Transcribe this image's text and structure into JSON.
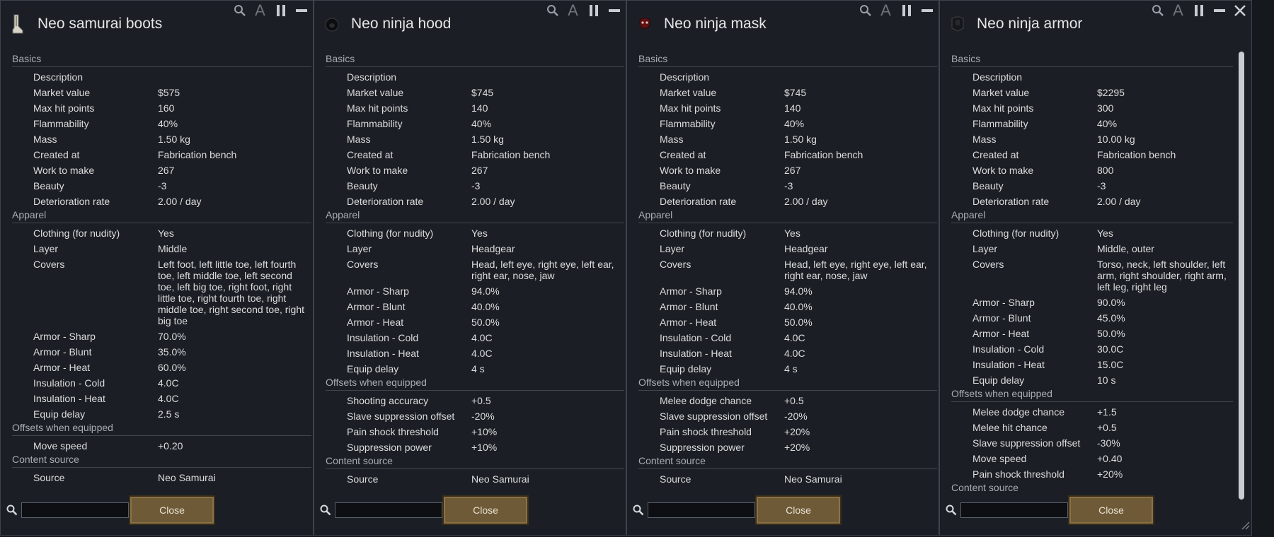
{
  "window_controls": [
    {
      "name": "search-icon",
      "glyph": "🔍"
    },
    {
      "name": "text-icon",
      "glyph": "A"
    },
    {
      "name": "pause-icon",
      "glyph": "II"
    },
    {
      "name": "minimize-icon",
      "glyph": "▬"
    }
  ],
  "close_x": "✕",
  "footer": {
    "close_label": "Close",
    "search_placeholder": ""
  },
  "panels": [
    {
      "title": "Neo samurai boots",
      "icon": "boots-icon",
      "sections": [
        {
          "title": "Basics",
          "rows": [
            [
              "Description",
              ""
            ],
            [
              "Market value",
              "$575"
            ],
            [
              "Max hit points",
              "160"
            ],
            [
              "Flammability",
              "40%"
            ],
            [
              "Mass",
              "1.50 kg"
            ],
            [
              "Created at",
              "Fabrication bench"
            ],
            [
              "Work to make",
              "267"
            ],
            [
              "Beauty",
              "-3"
            ],
            [
              "Deterioration rate",
              "2.00 / day"
            ]
          ]
        },
        {
          "title": "Apparel",
          "rows": [
            [
              "Clothing (for nudity)",
              "Yes"
            ],
            [
              "Layer",
              "Middle"
            ],
            [
              "Covers",
              "Left foot, left little toe, left fourth toe, left middle toe, left second toe, left big toe, right foot, right little toe, right fourth toe, right middle toe, right second toe, right big toe"
            ],
            [
              "Armor - Sharp",
              "70.0%"
            ],
            [
              "Armor - Blunt",
              "35.0%"
            ],
            [
              "Armor - Heat",
              "60.0%"
            ],
            [
              "Insulation - Cold",
              "4.0C"
            ],
            [
              "Insulation - Heat",
              "4.0C"
            ],
            [
              "Equip delay",
              "2.5 s"
            ]
          ]
        },
        {
          "title": "Offsets when equipped",
          "rows": [
            [
              "Move speed",
              "+0.20"
            ]
          ]
        },
        {
          "title": "Content source",
          "rows": [
            [
              "Source",
              "Neo Samurai"
            ]
          ]
        }
      ]
    },
    {
      "title": "Neo ninja hood",
      "icon": "hood-icon",
      "sections": [
        {
          "title": "Basics",
          "rows": [
            [
              "Description",
              ""
            ],
            [
              "Market value",
              "$745"
            ],
            [
              "Max hit points",
              "140"
            ],
            [
              "Flammability",
              "40%"
            ],
            [
              "Mass",
              "1.50 kg"
            ],
            [
              "Created at",
              "Fabrication bench"
            ],
            [
              "Work to make",
              "267"
            ],
            [
              "Beauty",
              "-3"
            ],
            [
              "Deterioration rate",
              "2.00 / day"
            ]
          ]
        },
        {
          "title": "Apparel",
          "rows": [
            [
              "Clothing (for nudity)",
              "Yes"
            ],
            [
              "Layer",
              "Headgear"
            ],
            [
              "Covers",
              "Head, left eye, right eye, left ear, right ear, nose, jaw"
            ],
            [
              "Armor - Sharp",
              "94.0%"
            ],
            [
              "Armor - Blunt",
              "40.0%"
            ],
            [
              "Armor - Heat",
              "50.0%"
            ],
            [
              "Insulation - Cold",
              "4.0C"
            ],
            [
              "Insulation - Heat",
              "4.0C"
            ],
            [
              "Equip delay",
              "4 s"
            ]
          ]
        },
        {
          "title": "Offsets when equipped",
          "rows": [
            [
              "Shooting accuracy",
              "+0.5"
            ],
            [
              "Slave suppression offset",
              "-20%"
            ],
            [
              "Pain shock threshold",
              "+10%"
            ],
            [
              "Suppression power",
              "+10%"
            ]
          ]
        },
        {
          "title": "Content source",
          "rows": [
            [
              "Source",
              "Neo Samurai"
            ]
          ]
        }
      ]
    },
    {
      "title": "Neo ninja mask",
      "icon": "mask-icon",
      "sections": [
        {
          "title": "Basics",
          "rows": [
            [
              "Description",
              ""
            ],
            [
              "Market value",
              "$745"
            ],
            [
              "Max hit points",
              "140"
            ],
            [
              "Flammability",
              "40%"
            ],
            [
              "Mass",
              "1.50 kg"
            ],
            [
              "Created at",
              "Fabrication bench"
            ],
            [
              "Work to make",
              "267"
            ],
            [
              "Beauty",
              "-3"
            ],
            [
              "Deterioration rate",
              "2.00 / day"
            ]
          ]
        },
        {
          "title": "Apparel",
          "rows": [
            [
              "Clothing (for nudity)",
              "Yes"
            ],
            [
              "Layer",
              "Headgear"
            ],
            [
              "Covers",
              "Head, left eye, right eye, left ear, right ear, nose, jaw"
            ],
            [
              "Armor - Sharp",
              "94.0%"
            ],
            [
              "Armor - Blunt",
              "40.0%"
            ],
            [
              "Armor - Heat",
              "50.0%"
            ],
            [
              "Insulation - Cold",
              "4.0C"
            ],
            [
              "Insulation - Heat",
              "4.0C"
            ],
            [
              "Equip delay",
              "4 s"
            ]
          ]
        },
        {
          "title": "Offsets when equipped",
          "rows": [
            [
              "Melee dodge chance",
              "+0.5"
            ],
            [
              "Slave suppression offset",
              "-20%"
            ],
            [
              "Pain shock threshold",
              "+20%"
            ],
            [
              "Suppression power",
              "+20%"
            ]
          ]
        },
        {
          "title": "Content source",
          "rows": [
            [
              "Source",
              "Neo Samurai"
            ]
          ]
        }
      ]
    },
    {
      "title": "Neo ninja armor",
      "icon": "armor-icon",
      "has_close_x": true,
      "has_scrollbar": true,
      "sections": [
        {
          "title": "Basics",
          "rows": [
            [
              "Description",
              ""
            ],
            [
              "Market value",
              "$2295"
            ],
            [
              "Max hit points",
              "300"
            ],
            [
              "Flammability",
              "40%"
            ],
            [
              "Mass",
              "10.00 kg"
            ],
            [
              "Created at",
              "Fabrication bench"
            ],
            [
              "Work to make",
              "800"
            ],
            [
              "Beauty",
              "-3"
            ],
            [
              "Deterioration rate",
              "2.00 / day"
            ]
          ]
        },
        {
          "title": "Apparel",
          "rows": [
            [
              "Clothing (for nudity)",
              "Yes"
            ],
            [
              "Layer",
              "Middle, outer"
            ],
            [
              "Covers",
              "Torso, neck, left shoulder, left arm, right shoulder, right arm, left leg, right leg"
            ],
            [
              "Armor - Sharp",
              "90.0%"
            ],
            [
              "Armor - Blunt",
              "45.0%"
            ],
            [
              "Armor - Heat",
              "50.0%"
            ],
            [
              "Insulation - Cold",
              "30.0C"
            ],
            [
              "Insulation - Heat",
              "15.0C"
            ],
            [
              "Equip delay",
              "10 s"
            ]
          ]
        },
        {
          "title": "Offsets when equipped",
          "rows": [
            [
              "Melee dodge chance",
              "+1.5"
            ],
            [
              "Melee hit chance",
              "+0.5"
            ],
            [
              "Slave suppression offset",
              "-30%"
            ],
            [
              "Move speed",
              "+0.40"
            ],
            [
              "Pain shock threshold",
              "+20%"
            ]
          ]
        },
        {
          "title": "Content source",
          "rows": []
        }
      ]
    }
  ]
}
